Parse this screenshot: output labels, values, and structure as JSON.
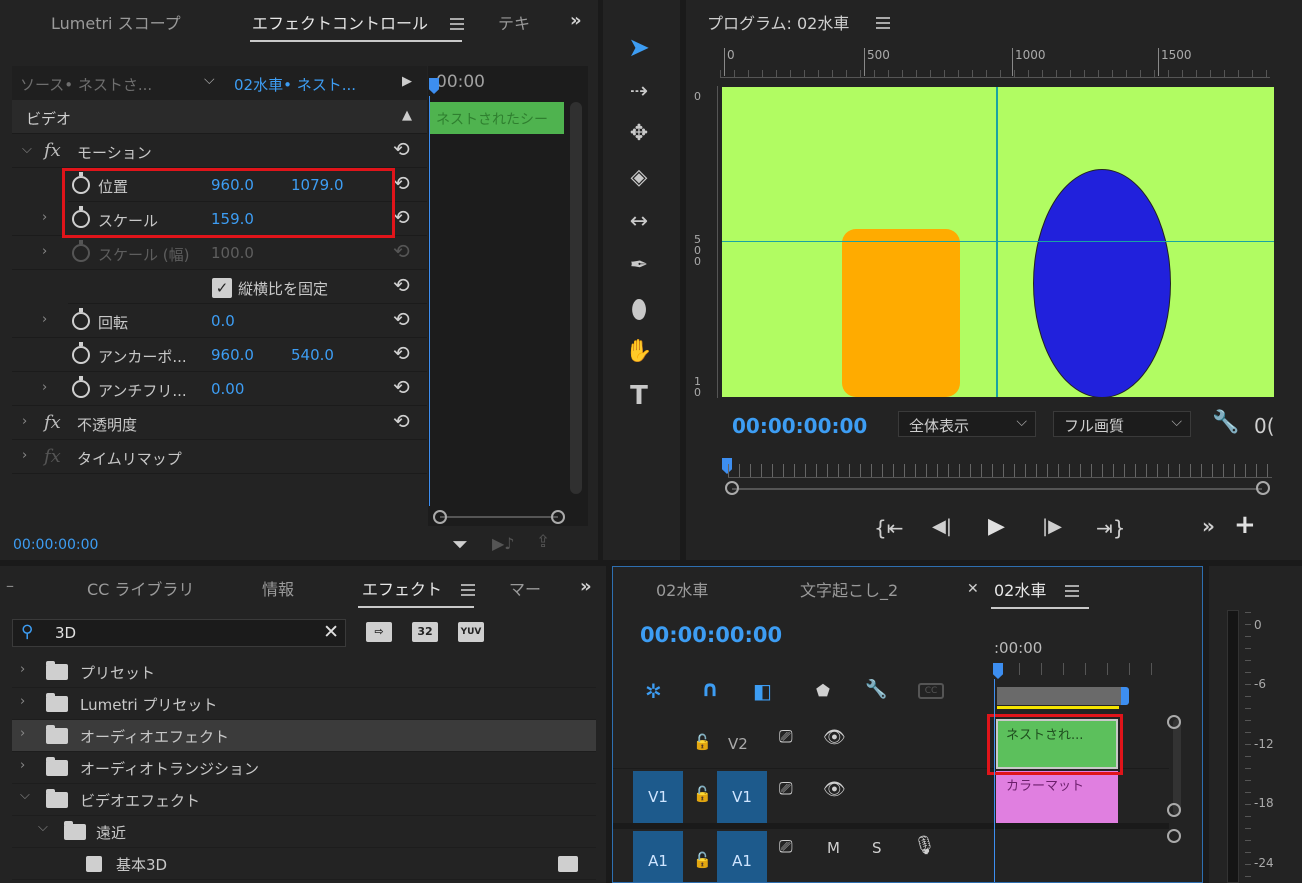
{
  "effect_controls": {
    "tabs": [
      "Lumetri スコープ",
      "エフェクトコントロール",
      "テキ"
    ],
    "source_label": "ソース• ネストさ...",
    "clip_label": "02水車• ネスト...",
    "timecode_header": "00:00",
    "clip_bar_label": "ネストされたシー",
    "section_video": "ビデオ",
    "motion": "モーション",
    "position_label": "位置",
    "position_x": "960.0",
    "position_y": "1079.0",
    "scale_label": "スケール",
    "scale_value": "159.0",
    "scale_width_label": "スケール (幅)",
    "scale_width_value": "100.0",
    "uniform_scale_label": "縦横比を固定",
    "rotation_label": "回転",
    "rotation_value": "0.0",
    "anchor_label": "アンカーポ...",
    "anchor_x": "960.0",
    "anchor_y": "540.0",
    "antiflicker_label": "アンチフリ...",
    "antiflicker_value": "0.00",
    "opacity": "不透明度",
    "time_remap": "タイムリマップ",
    "footer_timecode": "00:00:00:00"
  },
  "program_monitor": {
    "title": "プログラム: 02水車",
    "ruler_ticks": [
      "0",
      "500",
      "1000",
      "1500"
    ],
    "vruler_ticks": [
      "0",
      "5\n0\n0",
      "1\n0"
    ],
    "timecode": "00:00:00:00",
    "zoom_select": "全体表示",
    "quality_select": "フル画質",
    "overflow_text": "0(",
    "colors": {
      "background": "#b1fc62",
      "orange": "#ffab00",
      "blue": "#2121dc",
      "guide": "#1aa3a3"
    }
  },
  "effects_panel": {
    "tabs": [
      "CC ライブラリ",
      "情報",
      "エフェクト",
      "マー"
    ],
    "search_value": "3D",
    "badges": [
      "32",
      "YUV"
    ],
    "items": [
      {
        "label": "プリセット"
      },
      {
        "label": "Lumetri プリセット"
      },
      {
        "label": "オーディオエフェクト"
      },
      {
        "label": "オーディオトランジション"
      },
      {
        "label": "ビデオエフェクト"
      },
      {
        "label": "遠近"
      },
      {
        "label": "基本3D"
      }
    ]
  },
  "timeline": {
    "tabs": [
      "02水車",
      "文字起こし_2",
      "02水車"
    ],
    "timecode": "00:00:00:00",
    "ruler_label": ":00:00",
    "v2": "V2",
    "v1": "V1",
    "a1": "A1",
    "mute": "M",
    "solo": "S",
    "clip_nested": "ネストされ...",
    "clip_color_matte": "カラーマット",
    "clip_colors": {
      "nested": "#5cc05c",
      "matte": "#e07fe0"
    }
  },
  "audio_meter": {
    "labels": [
      "0",
      "-6",
      "-12",
      "-18",
      "-24"
    ]
  }
}
